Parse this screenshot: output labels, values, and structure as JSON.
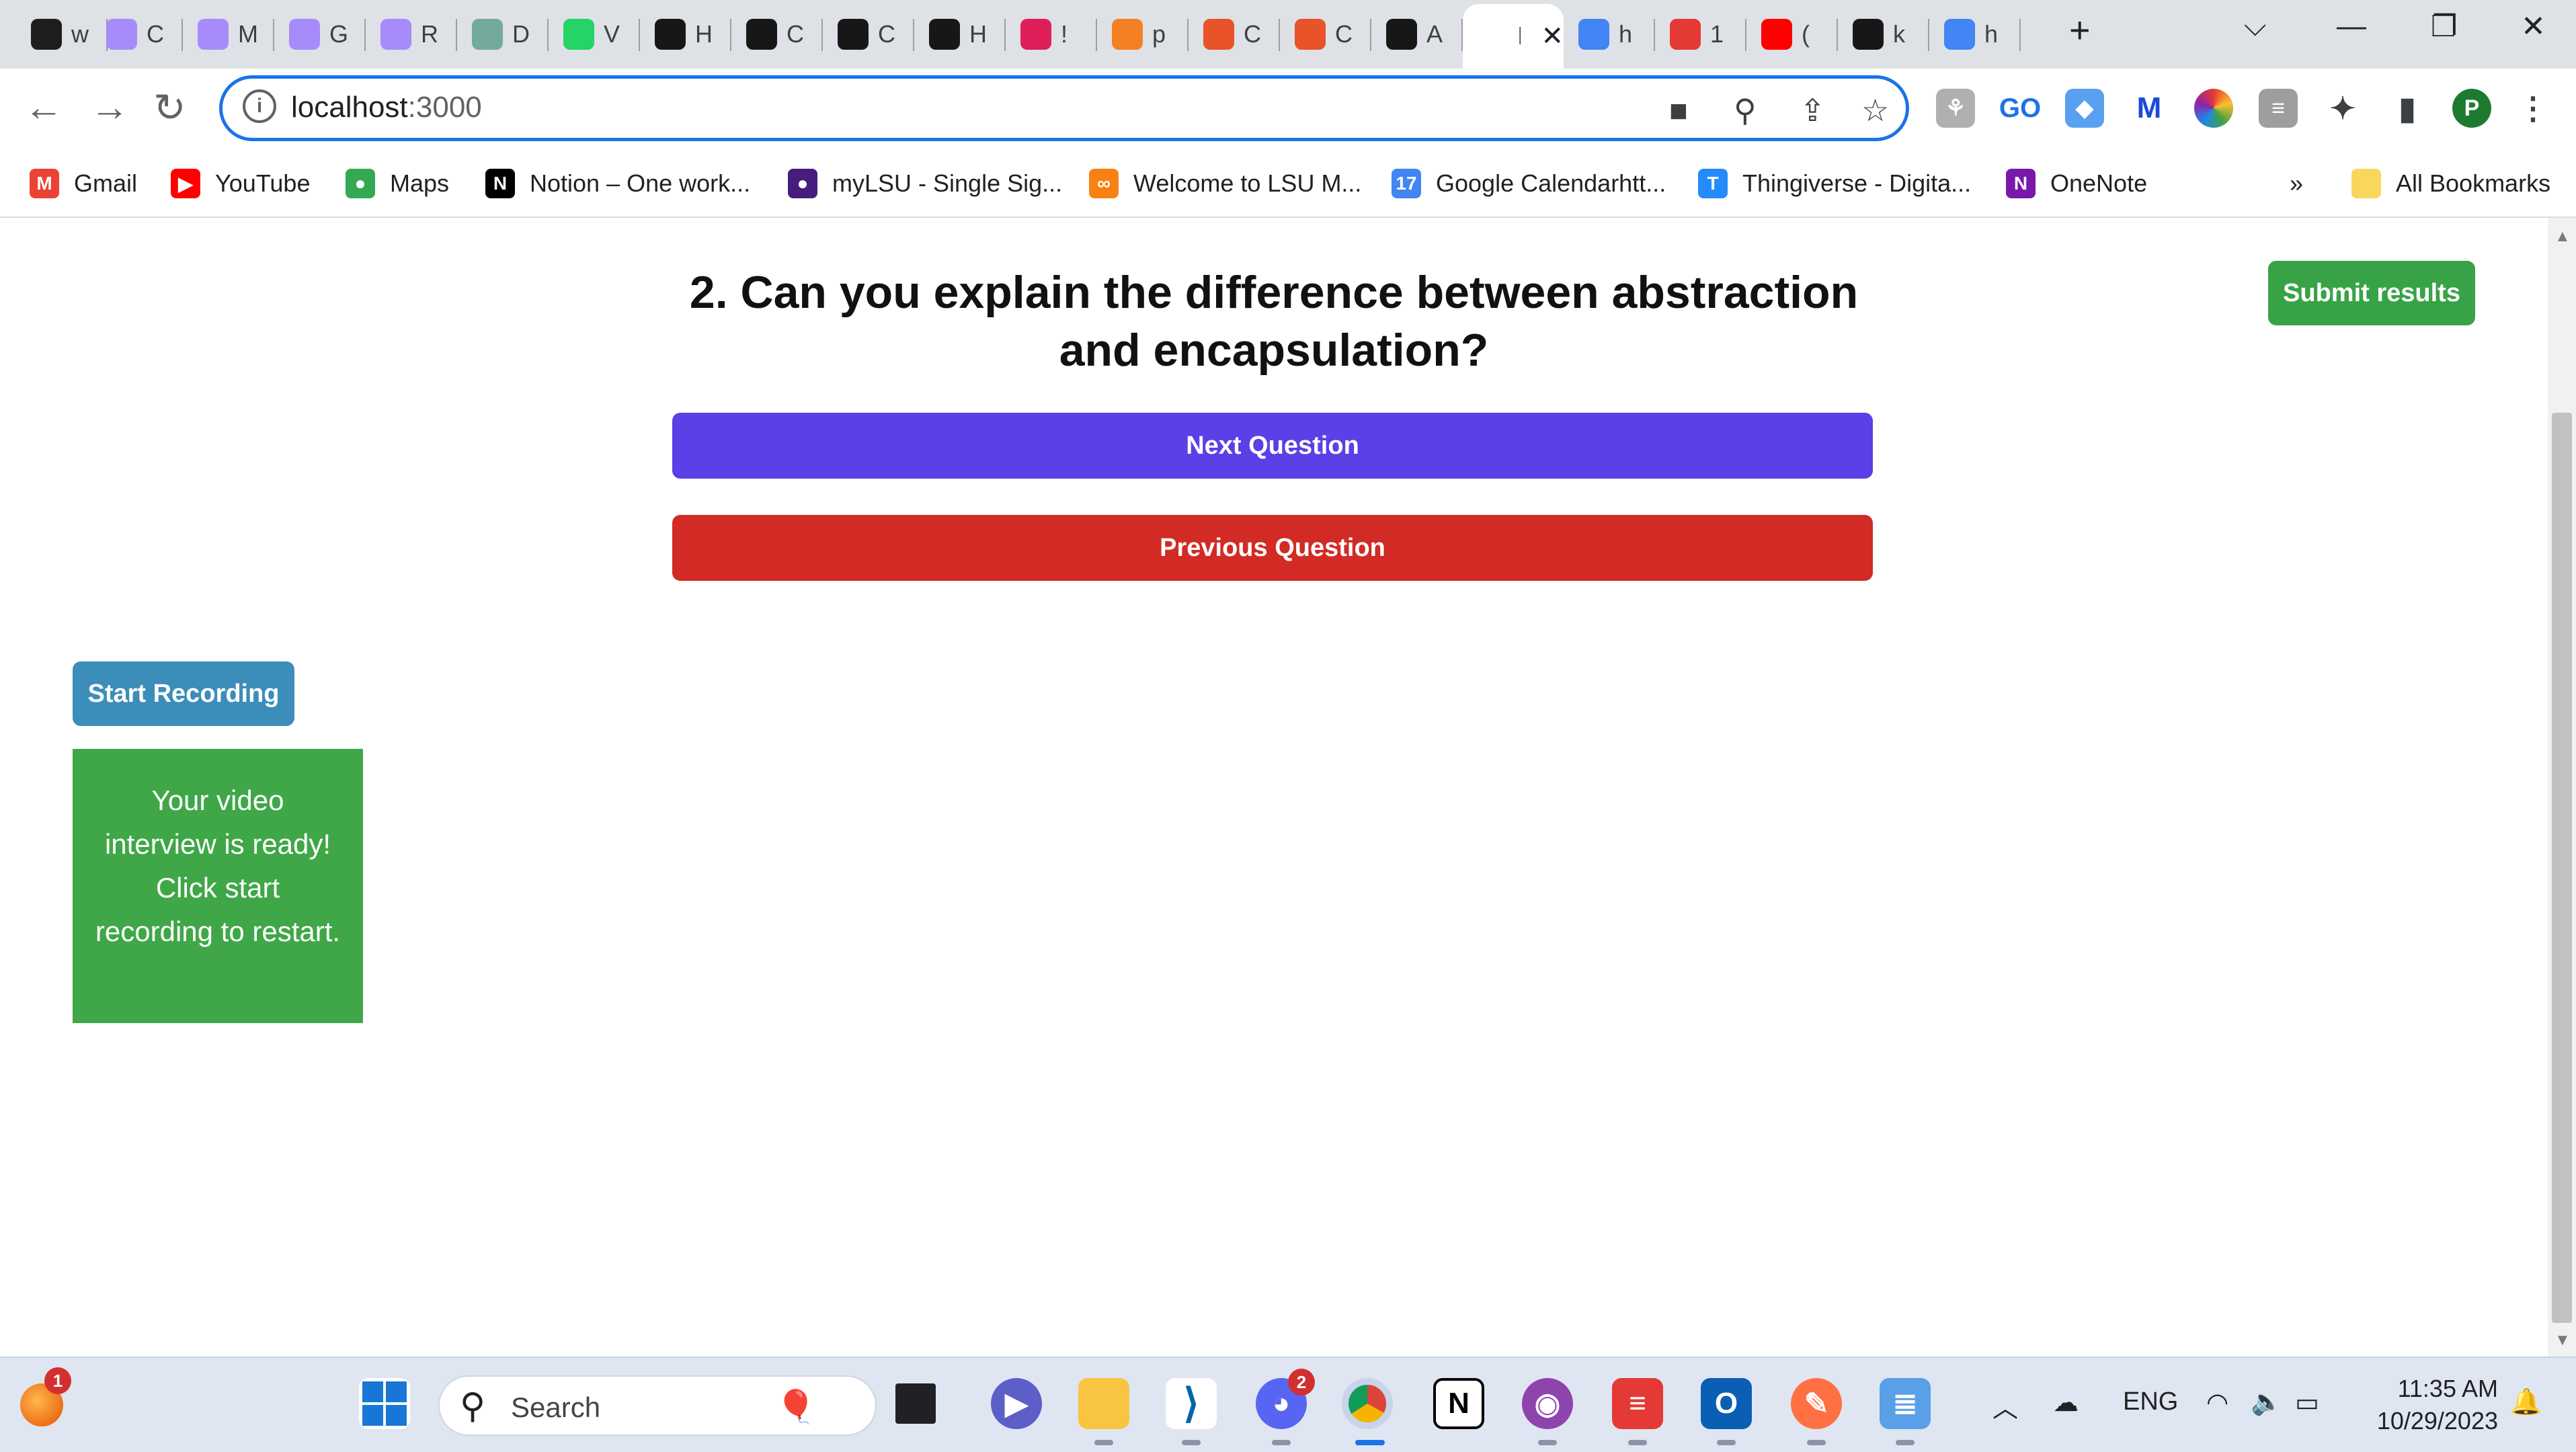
{
  "browser": {
    "tabs": [
      {
        "title": "w",
        "icon": "terminal-icon",
        "color": "#1e1e1e"
      },
      {
        "title": "C",
        "icon": "dots-icon",
        "color": "#a78bfa"
      },
      {
        "title": "M",
        "icon": "dots-icon",
        "color": "#a78bfa"
      },
      {
        "title": "G",
        "icon": "dots-icon",
        "color": "#a78bfa"
      },
      {
        "title": "R",
        "icon": "dots-icon",
        "color": "#a78bfa"
      },
      {
        "title": "D",
        "icon": "chatgpt-icon",
        "color": "#74aa9c"
      },
      {
        "title": "V",
        "icon": "whatsapp-icon",
        "color": "#25d366"
      },
      {
        "title": "H",
        "icon": "github-icon",
        "color": "#181717"
      },
      {
        "title": "C",
        "icon": "github-icon",
        "color": "#181717"
      },
      {
        "title": "C",
        "icon": "github-icon",
        "color": "#181717"
      },
      {
        "title": "H",
        "icon": "github-icon",
        "color": "#181717"
      },
      {
        "title": "!",
        "icon": "slack-icon",
        "color": "#e01e5a"
      },
      {
        "title": "p",
        "icon": "stackoverflow-icon",
        "color": "#f48024"
      },
      {
        "title": "C",
        "icon": "openai-icon",
        "color": "#e8532a"
      },
      {
        "title": "C",
        "icon": "openai-icon",
        "color": "#e8532a"
      },
      {
        "title": "A",
        "icon": "openai-icon",
        "color": "#181717"
      },
      {
        "title": "lc",
        "icon": "blank-icon",
        "color": "#ffffff",
        "active": true
      },
      {
        "title": "h",
        "icon": "google-icon",
        "color": "#4285f4"
      },
      {
        "title": "1",
        "icon": "arc-icon",
        "color": "#e53935"
      },
      {
        "title": "(",
        "icon": "youtube-icon",
        "color": "#ff0000"
      },
      {
        "title": "k",
        "icon": "github-icon",
        "color": "#181717"
      },
      {
        "title": "h",
        "icon": "google-icon",
        "color": "#4285f4"
      }
    ],
    "url_host": "localhost",
    "url_port": ":3000"
  },
  "bookmarks": [
    {
      "label": "Gmail",
      "icon": "gmail-icon",
      "color": "#ea4335",
      "glyph": "M"
    },
    {
      "label": "YouTube",
      "icon": "youtube-icon",
      "color": "#ff0000",
      "glyph": "▶"
    },
    {
      "label": "Maps",
      "icon": "maps-icon",
      "color": "#34a853",
      "glyph": "●"
    },
    {
      "label": "Notion – One work...",
      "icon": "notion-icon",
      "color": "#000000",
      "glyph": "N"
    },
    {
      "label": "myLSU - Single Sig...",
      "icon": "lsu-icon",
      "color": "#461d7c",
      "glyph": "●"
    },
    {
      "label": "Welcome to LSU M...",
      "icon": "moodle-icon",
      "color": "#f98012",
      "glyph": "∞"
    },
    {
      "label": "Google Calendarhtt...",
      "icon": "calendar-icon",
      "color": "#4285f4",
      "glyph": "17"
    },
    {
      "label": "Thingiverse - Digita...",
      "icon": "thingiverse-icon",
      "color": "#248bfb",
      "glyph": "T"
    },
    {
      "label": "OneNote",
      "icon": "onenote-icon",
      "color": "#7719aa",
      "glyph": "N"
    }
  ],
  "bookmarks_overflow": "»",
  "all_bookmarks_label": "All Bookmarks",
  "profile_initial": "P",
  "page": {
    "question": "2. Can you explain the difference between abstraction and encapsulation?",
    "next_label": "Next Question",
    "prev_label": "Previous Question",
    "submit_label": "Submit results",
    "record_label": "Start Recording",
    "status_message": "Your video interview is ready! Click start recording to restart.",
    "colors": {
      "next": "#5940e7",
      "prev": "#d22a24",
      "submit": "#38a346",
      "record": "#3c8dba",
      "status": "#3fa747"
    }
  },
  "taskbar": {
    "search_placeholder": "Search",
    "widget_badge": "1",
    "discord_badge": "2",
    "lang": "ENG",
    "time": "11:35 AM",
    "date": "10/29/2023"
  }
}
